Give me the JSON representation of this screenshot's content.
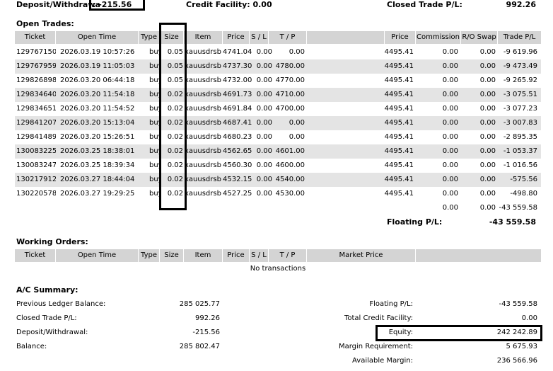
{
  "top": {
    "deposit_label": "Deposit/Withdrawa",
    "deposit_value": ": -215.56",
    "credit_facility": "Credit Facility: 0.00",
    "closed_pl_label": "Closed Trade P/L:",
    "closed_pl_value": "992.26"
  },
  "open_trades": {
    "title": "Open Trades:",
    "headers": [
      "Ticket",
      "Open Time",
      "Type",
      "Size",
      "Item",
      "Price",
      "S / L",
      "T / P",
      "Price",
      "Commission",
      "R/O Swap",
      "Trade P/L"
    ],
    "rows": [
      {
        "ticket": "129767150",
        "time": "2026.03.19 10:57:26",
        "type": "buy",
        "size": "0.05",
        "item": "xauusdrsb",
        "price": "4741.04",
        "sl": "0.00",
        "tp": "0.00",
        "cur": "4495.41",
        "comm": "0.00",
        "swap": "0.00",
        "pl": "-9 619.96"
      },
      {
        "ticket": "129767959",
        "time": "2026.03.19 11:05:03",
        "type": "buy",
        "size": "0.05",
        "item": "xauusdrsb",
        "price": "4737.30",
        "sl": "0.00",
        "tp": "4780.00",
        "cur": "4495.41",
        "comm": "0.00",
        "swap": "0.00",
        "pl": "-9 473.49"
      },
      {
        "ticket": "129826898",
        "time": "2026.03.20 06:44:18",
        "type": "buy",
        "size": "0.05",
        "item": "xauusdrsb",
        "price": "4732.00",
        "sl": "0.00",
        "tp": "4770.00",
        "cur": "4495.41",
        "comm": "0.00",
        "swap": "0.00",
        "pl": "-9 265.92"
      },
      {
        "ticket": "129834640",
        "time": "2026.03.20 11:54:18",
        "type": "buy",
        "size": "0.02",
        "item": "xauusdrsb",
        "price": "4691.73",
        "sl": "0.00",
        "tp": "4710.00",
        "cur": "4495.41",
        "comm": "0.00",
        "swap": "0.00",
        "pl": "-3 075.51"
      },
      {
        "ticket": "129834651",
        "time": "2026.03.20 11:54:52",
        "type": "buy",
        "size": "0.02",
        "item": "xauusdrsb",
        "price": "4691.84",
        "sl": "0.00",
        "tp": "4700.00",
        "cur": "4495.41",
        "comm": "0.00",
        "swap": "0.00",
        "pl": "-3 077.23"
      },
      {
        "ticket": "129841207",
        "time": "2026.03.20 15:13:04",
        "type": "buy",
        "size": "0.02",
        "item": "xauusdrsb",
        "price": "4687.41",
        "sl": "0.00",
        "tp": "0.00",
        "cur": "4495.41",
        "comm": "0.00",
        "swap": "0.00",
        "pl": "-3 007.83"
      },
      {
        "ticket": "129841489",
        "time": "2026.03.20 15:26:51",
        "type": "buy",
        "size": "0.02",
        "item": "xauusdrsb",
        "price": "4680.23",
        "sl": "0.00",
        "tp": "0.00",
        "cur": "4495.41",
        "comm": "0.00",
        "swap": "0.00",
        "pl": "-2 895.35"
      },
      {
        "ticket": "130083225",
        "time": "2026.03.25 18:38:01",
        "type": "buy",
        "size": "0.02",
        "item": "xauusdrsb",
        "price": "4562.65",
        "sl": "0.00",
        "tp": "4601.00",
        "cur": "4495.41",
        "comm": "0.00",
        "swap": "0.00",
        "pl": "-1 053.37"
      },
      {
        "ticket": "130083247",
        "time": "2026.03.25 18:39:34",
        "type": "buy",
        "size": "0.02",
        "item": "xauusdrsb",
        "price": "4560.30",
        "sl": "0.00",
        "tp": "4600.00",
        "cur": "4495.41",
        "comm": "0.00",
        "swap": "0.00",
        "pl": "-1 016.56"
      },
      {
        "ticket": "130217912",
        "time": "2026.03.27 18:44:04",
        "type": "buy",
        "size": "0.02",
        "item": "xauusdrsb",
        "price": "4532.15",
        "sl": "0.00",
        "tp": "4540.00",
        "cur": "4495.41",
        "comm": "0.00",
        "swap": "0.00",
        "pl": "-575.56"
      },
      {
        "ticket": "130220578",
        "time": "2026.03.27 19:29:25",
        "type": "buy",
        "size": "0.02",
        "item": "xauusdrsb",
        "price": "4527.25",
        "sl": "0.00",
        "tp": "4530.00",
        "cur": "4495.41",
        "comm": "0.00",
        "swap": "0.00",
        "pl": "-498.80"
      }
    ],
    "totals": {
      "comm": "0.00",
      "swap": "0.00",
      "pl": "-43 559.58"
    },
    "floating_label": "Floating P/L:",
    "floating_value": "-43 559.58"
  },
  "working_orders": {
    "title": "Working Orders:",
    "headers": [
      "Ticket",
      "Open Time",
      "Type",
      "Size",
      "Item",
      "Price",
      "S / L",
      "T / P",
      "Market Price"
    ],
    "empty_text": "No transactions"
  },
  "summary": {
    "title": "A/C Summary:",
    "left": [
      {
        "label": "Previous Ledger Balance:",
        "value": "285 025.77"
      },
      {
        "label": "Closed Trade P/L:",
        "value": "992.26"
      },
      {
        "label": "Deposit/Withdrawal:",
        "value": "-215.56"
      },
      {
        "label": "Balance:",
        "value": "285 802.47"
      }
    ],
    "right": [
      {
        "label": "Floating P/L:",
        "value": "-43 559.58"
      },
      {
        "label": "Total Credit Facility:",
        "value": "0.00"
      },
      {
        "label": "Equity:",
        "value": "242 242.89"
      },
      {
        "label": "Margin Requirement:",
        "value": "5 675.93"
      },
      {
        "label": "Available Margin:",
        "value": "236 566.96"
      }
    ]
  }
}
